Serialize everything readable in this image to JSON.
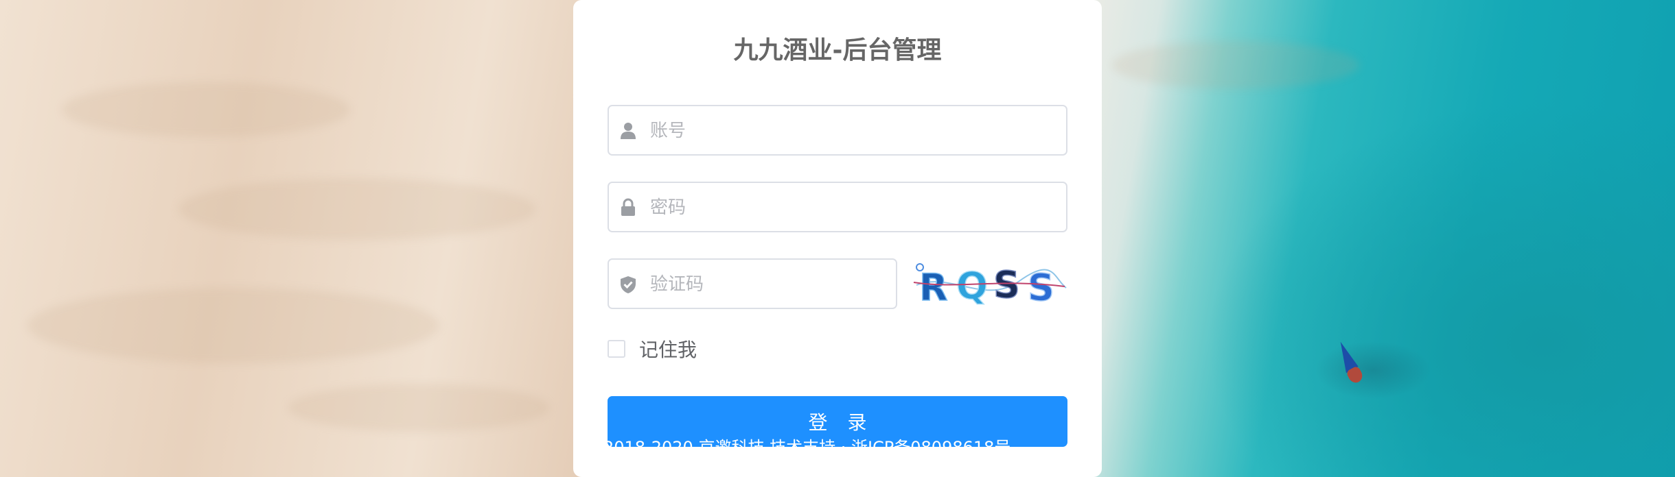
{
  "page": {
    "title": "九九酒业-后台管理"
  },
  "form": {
    "username": {
      "placeholder": "账号",
      "value": ""
    },
    "password": {
      "placeholder": "密码",
      "value": ""
    },
    "captcha": {
      "placeholder": "验证码",
      "value": "",
      "image_text": "RQSS"
    },
    "remember": {
      "label": "记住我",
      "checked": false
    },
    "submit_label": "登 录"
  },
  "footer": {
    "text": "2018-2020 京邀科技 技术支持 · 浙ICP备08098618号"
  },
  "icons": {
    "username": "user-icon",
    "password": "lock-icon",
    "captcha": "shield-check-icon"
  },
  "colors": {
    "primary": "#1e90ff",
    "title": "#666666",
    "placeholder": "#b4b6bb",
    "border": "#dcdfe6"
  }
}
